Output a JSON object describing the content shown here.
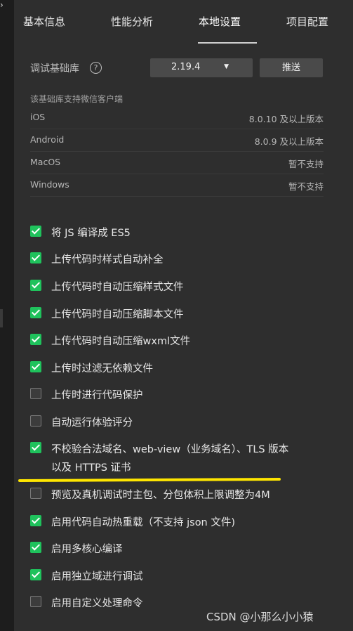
{
  "tabs": [
    {
      "label": "基本信息",
      "active": false
    },
    {
      "label": "性能分析",
      "active": false
    },
    {
      "label": "本地设置",
      "active": true
    },
    {
      "label": "项目配置",
      "active": false
    }
  ],
  "library": {
    "label": "调试基础库",
    "help_icon": "?",
    "version": "2.19.4",
    "push_label": "推送"
  },
  "support": {
    "title": "该基础库支持微信客户端",
    "rows": [
      {
        "name": "iOS",
        "value": "8.0.10 及以上版本"
      },
      {
        "name": "Android",
        "value": "8.0.9 及以上版本"
      },
      {
        "name": "MacOS",
        "value": "暂不支持"
      },
      {
        "name": "Windows",
        "value": "暂不支持"
      }
    ]
  },
  "options": [
    {
      "label": "将 JS 编译成 ES5",
      "checked": true
    },
    {
      "label": "上传代码时样式自动补全",
      "checked": true
    },
    {
      "label": "上传代码时自动压缩样式文件",
      "checked": true
    },
    {
      "label": "上传代码时自动压缩脚本文件",
      "checked": true
    },
    {
      "label": "上传代码时自动压缩wxml文件",
      "checked": true
    },
    {
      "label": "上传时过滤无依赖文件",
      "checked": true
    },
    {
      "label": "上传时进行代码保护",
      "checked": false
    },
    {
      "label": "自动运行体验评分",
      "checked": false
    },
    {
      "label": "不校验合法域名、web-view（业务域名）、TLS 版本以及 HTTPS 证书",
      "checked": true
    },
    {
      "label": "预览及真机调试时主包、分包体积上限调整为4M",
      "checked": false
    },
    {
      "label": "启用代码自动热重载（不支持 json 文件)",
      "checked": true
    },
    {
      "label": "启用多核心编译",
      "checked": true
    },
    {
      "label": "启用独立域进行调试",
      "checked": true
    },
    {
      "label": "启用自定义处理命令",
      "checked": false
    }
  ],
  "watermark": "CSDN @小那么小小猿",
  "colors": {
    "accent_green": "#1fc25c",
    "highlight_yellow": "#ffe600",
    "background": "#2e2e2e"
  }
}
